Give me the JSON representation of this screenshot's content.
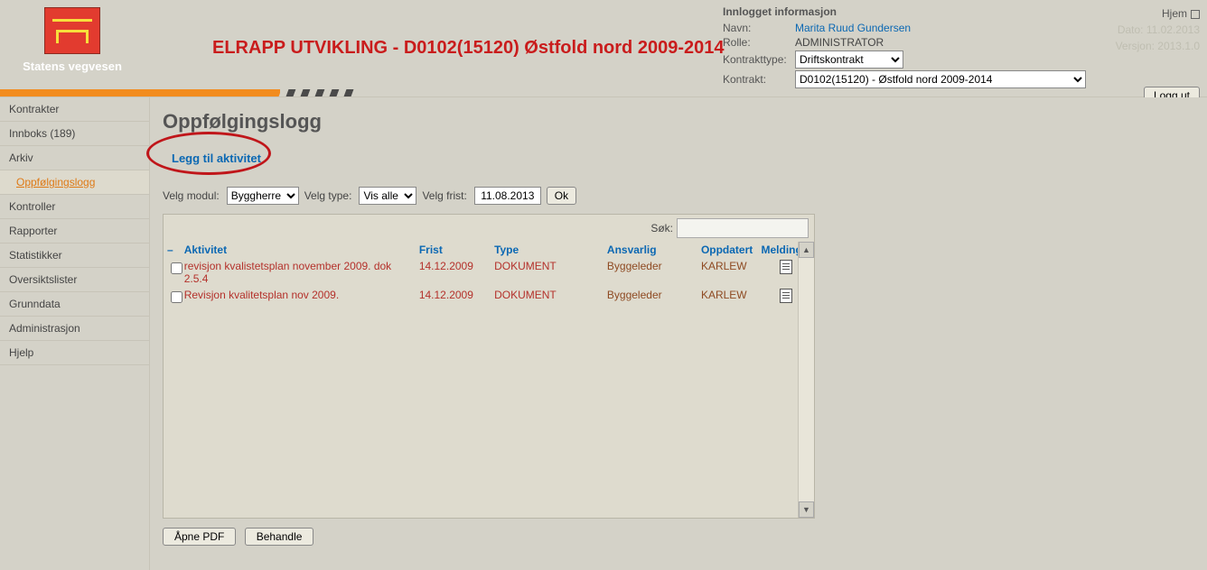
{
  "brand": {
    "name": "Statens vegvesen"
  },
  "banner_title": "ELRAPP UTVIKLING - D0102(15120) Østfold nord 2009-2014",
  "info_panel": {
    "title": "Innlogget informasjon",
    "navn_label": "Navn:",
    "navn_value": "Marita Ruud Gundersen",
    "rolle_label": "Rolle:",
    "rolle_value": "ADMINISTRATOR",
    "kontrakttype_label": "Kontrakttype:",
    "kontrakttype_selected": "Driftskontrakt",
    "kontrakt_label": "Kontrakt:",
    "kontrakt_selected": "D0102(15120) - Østfold nord 2009-2014",
    "hjem": "Hjem",
    "date_label": "Dato: 11.02.2013",
    "version_label": "Versjon:    2013.1.0",
    "logout": "Logg ut"
  },
  "sidebar": {
    "items": [
      {
        "label": "Kontrakter",
        "active": false
      },
      {
        "label": "Innboks (189)",
        "active": false
      },
      {
        "label": "Arkiv",
        "active": false
      },
      {
        "label": "Oppfølgingslogg",
        "active": true
      },
      {
        "label": "Kontroller",
        "active": false
      },
      {
        "label": "Rapporter",
        "active": false
      },
      {
        "label": "Statistikker",
        "active": false
      },
      {
        "label": "Oversiktslister",
        "active": false
      },
      {
        "label": "Grunndata",
        "active": false
      },
      {
        "label": "Administrasjon",
        "active": false
      },
      {
        "label": "Hjelp",
        "active": false
      }
    ]
  },
  "page": {
    "title": "Oppfølgingslogg",
    "add_activity": "Legg til aktivitet"
  },
  "filters": {
    "modul_label": "Velg modul:",
    "modul_selected": "Byggherre",
    "type_label": "Velg type:",
    "type_selected": "Vis alle",
    "frist_label": "Velg frist:",
    "frist_value": "11.08.2013",
    "ok": "Ok"
  },
  "grid": {
    "search_label": "Søk:",
    "search_value": "",
    "headers": {
      "aktivitet": "Aktivitet",
      "frist": "Frist",
      "type": "Type",
      "ansvarlig": "Ansvarlig",
      "oppdatert": "Oppdatert",
      "melding": "Melding"
    },
    "rows": [
      {
        "aktivitet": "revisjon kvalistetsplan november 2009. dok 2.5.4",
        "frist": "14.12.2009",
        "type": "DOKUMENT",
        "ansvarlig": "Byggeleder",
        "oppdatert": "KARLEW"
      },
      {
        "aktivitet": "Revisjon kvalitetsplan nov 2009.",
        "frist": "14.12.2009",
        "type": "DOKUMENT",
        "ansvarlig": "Byggeleder",
        "oppdatert": "KARLEW"
      }
    ]
  },
  "actions": {
    "open_pdf": "Åpne PDF",
    "behandle": "Behandle"
  }
}
